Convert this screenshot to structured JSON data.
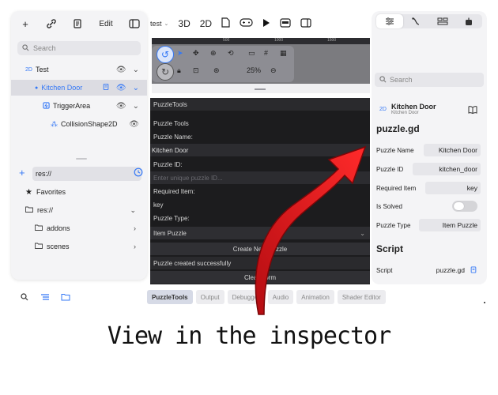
{
  "left_panel": {
    "toolbar": {
      "edit_label": "Edit"
    },
    "search_placeholder": "Search",
    "scene_tree": [
      {
        "badge": "2D",
        "label": "Test"
      },
      {
        "label": "Kitchen Door"
      },
      {
        "label": "TriggerArea"
      },
      {
        "label": "CollisionShape2D"
      }
    ],
    "filesystem": {
      "path": "res://",
      "items": [
        {
          "label": "Favorites"
        },
        {
          "label": "res://"
        },
        {
          "label": "addons"
        },
        {
          "label": "scenes"
        }
      ]
    }
  },
  "top_bar": {
    "scene_name": "test",
    "mode_3d": "3D",
    "mode_2d": "2D"
  },
  "viewport": {
    "ruler_marks": [
      "500",
      "1000",
      "1500"
    ],
    "zoom": "25%"
  },
  "bottom_tabs": [
    "PuzzleTools",
    "Output",
    "Debugger",
    "Audio",
    "Animation",
    "Shader Editor"
  ],
  "dock_panel": {
    "header": "PuzzleTools",
    "title": "Puzzle Tools",
    "name_label": "Puzzle Name:",
    "name_value": "Kitchen Door",
    "id_label": "Puzzle ID:",
    "id_placeholder": "Enter unique puzzle ID...",
    "item_label": "Required Item:",
    "item_value": "key",
    "type_label": "Puzzle Type:",
    "type_value": "Item Puzzle",
    "create_button": "Create New Puzzle",
    "status": "Puzzle created successfully",
    "confirm_button": "Clear Form"
  },
  "inspector": {
    "search_placeholder": "Search",
    "node_badge": "2D",
    "node_name": "Kitchen Door",
    "node_type": "Kitchen Door",
    "script_title": "puzzle.gd",
    "properties": [
      {
        "label": "Puzzle Name",
        "value": "Kitchen Door"
      },
      {
        "label": "Puzzle ID",
        "value": "kitchen_door"
      },
      {
        "label": "Required Item",
        "value": "key"
      },
      {
        "label": "Is Solved",
        "value": ""
      },
      {
        "label": "Puzzle Type",
        "value": "Item Puzzle"
      }
    ],
    "is_solved": false,
    "script_section": "Script",
    "script_label": "Script",
    "script_value": "puzzle.gd"
  },
  "annotation": {
    "caption": "View in the inspector",
    "arrow_color": "#e0141b"
  }
}
